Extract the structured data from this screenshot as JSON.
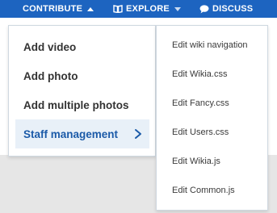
{
  "colors": {
    "nav_bg": "#1d64c0",
    "nav_text": "#ffffff",
    "active_item_bg": "#e8f0f8",
    "active_item_text": "#1b5aa8",
    "page_bg": "#e6e6e6"
  },
  "nav": {
    "contribute": {
      "label": "CONTRIBUTE",
      "icon": "caret-up-icon"
    },
    "explore": {
      "label": "EXPLORE",
      "icon": "book-icon",
      "caret": "caret-down-icon"
    },
    "discuss": {
      "label": "DISCUSS",
      "icon": "speech-bubble-icon"
    }
  },
  "contribute_menu": {
    "items": [
      {
        "label": "Add video"
      },
      {
        "label": "Add photo"
      },
      {
        "label": "Add multiple photos"
      },
      {
        "label": "Staff management",
        "active": true,
        "icon": "chevron-right-icon"
      }
    ]
  },
  "staff_submenu": {
    "items": [
      {
        "label": "Edit wiki navigation"
      },
      {
        "label": "Edit Wikia.css"
      },
      {
        "label": "Edit Fancy.css"
      },
      {
        "label": "Edit Users.css"
      },
      {
        "label": "Edit Wikia.js"
      },
      {
        "label": "Edit Common.js"
      }
    ]
  }
}
